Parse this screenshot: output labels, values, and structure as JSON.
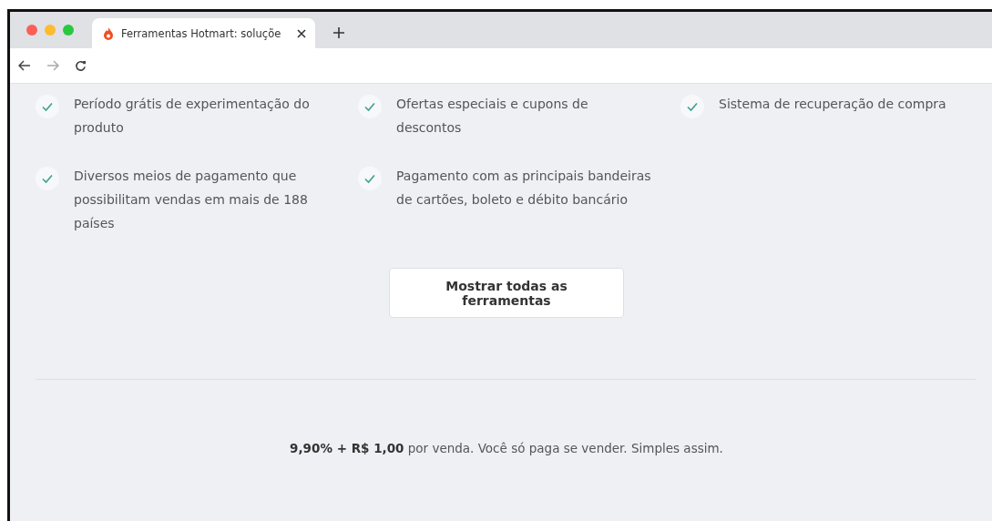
{
  "browser": {
    "tab": {
      "title": "Ferramentas Hotmart: soluçõe",
      "selected": true
    }
  },
  "features": [
    {
      "text": "Período grátis de experimentação do produto"
    },
    {
      "text": "Ofertas especiais e cupons de descontos"
    },
    {
      "text": "Sistema de recuperação de compra"
    },
    {
      "text": "Diversos meios de pagamento que possibilitam vendas em mais de 188 países"
    },
    {
      "text": "Pagamento com as principais bandeiras de cartões, boleto e débito bancário"
    }
  ],
  "show_all_button": "Mostrar todas as ferramentas",
  "pricing": "**9,90% + R$ 1,00** por venda. Você só paga se vender. Simples assim."
}
